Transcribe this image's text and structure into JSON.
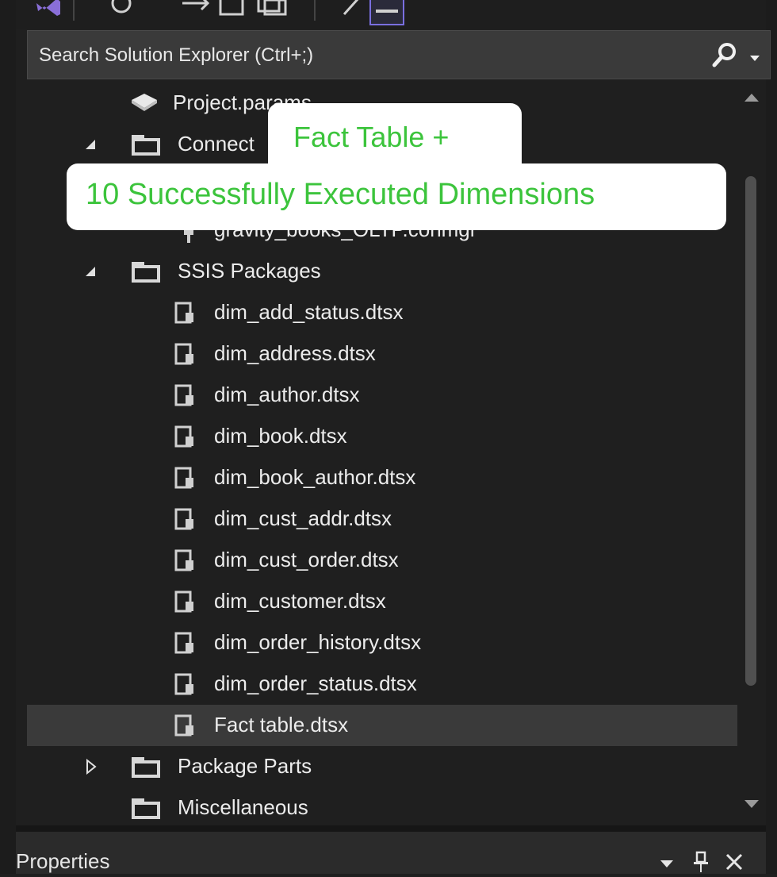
{
  "search": {
    "placeholder": "Search Solution Explorer (Ctrl+;)"
  },
  "tree": {
    "project_params": "Project.params",
    "connection_managers": "Connect",
    "connection_item": "gravity_books_OLTP.conmgr",
    "ssis_packages": "SSIS Packages",
    "packages": [
      "dim_add_status.dtsx",
      "dim_address.dtsx",
      "dim_author.dtsx",
      "dim_book.dtsx",
      "dim_book_author.dtsx",
      "dim_cust_addr.dtsx",
      "dim_cust_order.dtsx",
      "dim_customer.dtsx",
      "dim_order_history.dtsx",
      "dim_order_status.dtsx",
      "Fact table.dtsx"
    ],
    "package_parts": "Package Parts",
    "miscellaneous": "Miscellaneous"
  },
  "properties": {
    "title": "Properties"
  },
  "callouts": {
    "line1": "Fact Table +",
    "line2": "10 Successfully Executed Dimensions"
  },
  "colors": {
    "background": "#1f1f1f",
    "selected_row": "#3a3a3a",
    "callout_text": "#3cc43c"
  }
}
